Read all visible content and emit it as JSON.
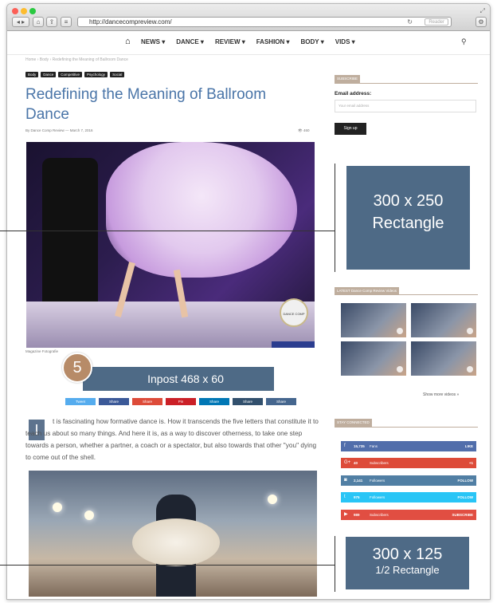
{
  "browser": {
    "url": "http://dancecompreview.com/",
    "reader_label": "Reader"
  },
  "nav": {
    "items": [
      {
        "label": "NEWS ▾"
      },
      {
        "label": "DANCE ▾"
      },
      {
        "label": "REVIEW ▾"
      },
      {
        "label": "FASHION ▾"
      },
      {
        "label": "BODY ▾"
      },
      {
        "label": "VIDS ▾"
      }
    ]
  },
  "article": {
    "breadcrumb": "Home › Body › Redefining the Meaning of Ballroom Dance",
    "tags": [
      "Body",
      "Dance",
      "Competitive",
      "Psychology",
      "Social"
    ],
    "title": "Redefining the Meaning of Ballroom Dance",
    "byline": "By Dance Comp Review — March 7, 2016",
    "views": "460",
    "image_caption": "Magazine Fotografie",
    "hero_logo_text": "DANCE COMP REVIEW",
    "dropcap": "I",
    "body": "t is fascinating how formative dance is. How it transcends the five letters that constitute it to teach us about so many things. And here it is, as a way to discover otherness, to take one step towards a person, whether a partner, a coach or a spectator, but also towards that other \"you\" dying to come out of the shell."
  },
  "share_buttons": [
    {
      "label": "Tweet",
      "color": "#55acee"
    },
    {
      "label": "Share",
      "color": "#3b5998"
    },
    {
      "label": "Share",
      "color": "#dd4b39"
    },
    {
      "label": "Pin",
      "color": "#cb2027"
    },
    {
      "label": "Share",
      "color": "#0077b5"
    },
    {
      "label": "Share",
      "color": "#32506d"
    },
    {
      "label": "Share",
      "color": "#45668e"
    }
  ],
  "overlays": {
    "badge_number": "5",
    "inpost_label": "Inpost   468 x 60",
    "rect_line1": "300 x 250",
    "rect_line2": "Rectangle",
    "small_line1": "300 x 125",
    "small_line2": "1/2 Rectangle"
  },
  "sidebar": {
    "subscribe_heading": "SUBSCRIBE",
    "email_label": "Email address:",
    "email_placeholder": "Your email address",
    "signup_label": "Sign up",
    "videos_heading": "LATEST Dance Comp Review Videos",
    "more_videos": "Show more videos »",
    "stay_connected_heading": "STAY CONNECTED",
    "social": [
      {
        "icon": "f",
        "count": "15,735",
        "label": "Fans",
        "action": "LIKE",
        "color": "#516eab"
      },
      {
        "icon": "G+",
        "count": "40",
        "label": "Subscribers",
        "action": "+1",
        "color": "#dd4b39"
      },
      {
        "icon": "◙",
        "count": "2,141",
        "label": "Followers",
        "action": "FOLLOW",
        "color": "#517fa4"
      },
      {
        "icon": "t",
        "count": "975",
        "label": "Followers",
        "action": "FOLLOW",
        "color": "#29c5f6"
      },
      {
        "icon": "▶",
        "count": "989",
        "label": "Subscribers",
        "action": "SUBSCRIBE",
        "color": "#e14e42"
      }
    ]
  },
  "colors": {
    "accent": "#4a75a8",
    "ad_block": "#4e6a86",
    "sidebar_heading": "#bfae9e",
    "badge": "#b78b68"
  }
}
